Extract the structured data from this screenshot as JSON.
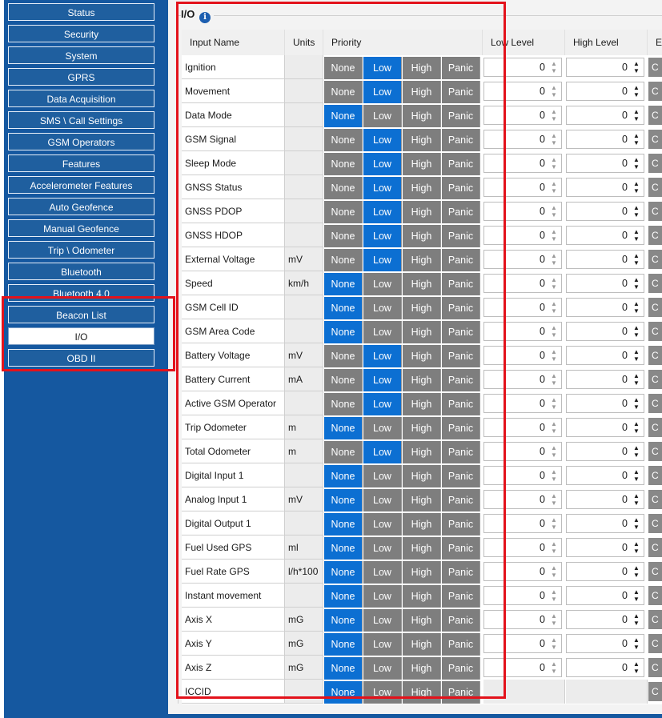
{
  "sidebar": {
    "items": [
      {
        "label": "Status",
        "active": false
      },
      {
        "label": "Security",
        "active": false
      },
      {
        "label": "System",
        "active": false
      },
      {
        "label": "GPRS",
        "active": false
      },
      {
        "label": "Data Acquisition",
        "active": false
      },
      {
        "label": "SMS \\ Call Settings",
        "active": false
      },
      {
        "label": "GSM Operators",
        "active": false
      },
      {
        "label": "Features",
        "active": false
      },
      {
        "label": "Accelerometer Features",
        "active": false
      },
      {
        "label": "Auto Geofence",
        "active": false
      },
      {
        "label": "Manual Geofence",
        "active": false
      },
      {
        "label": "Trip \\ Odometer",
        "active": false
      },
      {
        "label": "Bluetooth",
        "active": false
      },
      {
        "label": "Bluetooth 4.0",
        "active": false
      },
      {
        "label": "Beacon List",
        "active": false
      },
      {
        "label": "I/O",
        "active": true
      },
      {
        "label": "OBD II",
        "active": false
      }
    ]
  },
  "section": {
    "title": "I/O",
    "info_icon": "info-icon"
  },
  "table": {
    "headers": {
      "name": "Input Name",
      "units": "Units",
      "priority": "Priority",
      "low": "Low Level",
      "high": "High Level",
      "next": "E"
    },
    "priority_options": [
      "None",
      "Low",
      "High",
      "Panic"
    ],
    "stub_text": "C",
    "rows": [
      {
        "name": "Ignition",
        "units": "",
        "priority": "Low",
        "low": "0",
        "high": "0"
      },
      {
        "name": "Movement",
        "units": "",
        "priority": "Low",
        "low": "0",
        "high": "0"
      },
      {
        "name": "Data Mode",
        "units": "",
        "priority": "None",
        "low": "0",
        "high": "0"
      },
      {
        "name": "GSM Signal",
        "units": "",
        "priority": "Low",
        "low": "0",
        "high": "0"
      },
      {
        "name": "Sleep Mode",
        "units": "",
        "priority": "Low",
        "low": "0",
        "high": "0"
      },
      {
        "name": "GNSS Status",
        "units": "",
        "priority": "Low",
        "low": "0",
        "high": "0"
      },
      {
        "name": "GNSS PDOP",
        "units": "",
        "priority": "Low",
        "low": "0",
        "high": "0"
      },
      {
        "name": "GNSS HDOP",
        "units": "",
        "priority": "Low",
        "low": "0",
        "high": "0"
      },
      {
        "name": "External Voltage",
        "units": "mV",
        "priority": "Low",
        "low": "0",
        "high": "0"
      },
      {
        "name": "Speed",
        "units": "km/h",
        "priority": "None",
        "low": "0",
        "high": "0"
      },
      {
        "name": "GSM Cell ID",
        "units": "",
        "priority": "None",
        "low": "0",
        "high": "0"
      },
      {
        "name": "GSM Area Code",
        "units": "",
        "priority": "None",
        "low": "0",
        "high": "0"
      },
      {
        "name": "Battery Voltage",
        "units": "mV",
        "priority": "Low",
        "low": "0",
        "high": "0"
      },
      {
        "name": "Battery Current",
        "units": "mA",
        "priority": "Low",
        "low": "0",
        "high": "0"
      },
      {
        "name": "Active GSM Operator",
        "units": "",
        "priority": "Low",
        "low": "0",
        "high": "0"
      },
      {
        "name": "Trip Odometer",
        "units": "m",
        "priority": "None",
        "low": "0",
        "high": "0"
      },
      {
        "name": "Total Odometer",
        "units": "m",
        "priority": "Low",
        "low": "0",
        "high": "0"
      },
      {
        "name": "Digital Input 1",
        "units": "",
        "priority": "None",
        "low": "0",
        "high": "0"
      },
      {
        "name": "Analog Input 1",
        "units": "mV",
        "priority": "None",
        "low": "0",
        "high": "0"
      },
      {
        "name": "Digital Output 1",
        "units": "",
        "priority": "None",
        "low": "0",
        "high": "0"
      },
      {
        "name": "Fuel Used GPS",
        "units": "ml",
        "priority": "None",
        "low": "0",
        "high": "0"
      },
      {
        "name": "Fuel Rate GPS",
        "units": "l/h*100",
        "priority": "None",
        "low": "0",
        "high": "0"
      },
      {
        "name": "Instant movement",
        "units": "",
        "priority": "None",
        "low": "0",
        "high": "0"
      },
      {
        "name": "Axis X",
        "units": "mG",
        "priority": "None",
        "low": "0",
        "high": "0"
      },
      {
        "name": "Axis Y",
        "units": "mG",
        "priority": "None",
        "low": "0",
        "high": "0"
      },
      {
        "name": "Axis Z",
        "units": "mG",
        "priority": "None",
        "low": "0",
        "high": "0"
      },
      {
        "name": "ICCID",
        "units": "",
        "priority": "None",
        "low": "",
        "high": ""
      }
    ]
  },
  "colors": {
    "sidebar": "#1558a0",
    "selected": "#0c6fd2",
    "unselected": "#7e7e7e",
    "highlight_box": "#e3121b"
  }
}
